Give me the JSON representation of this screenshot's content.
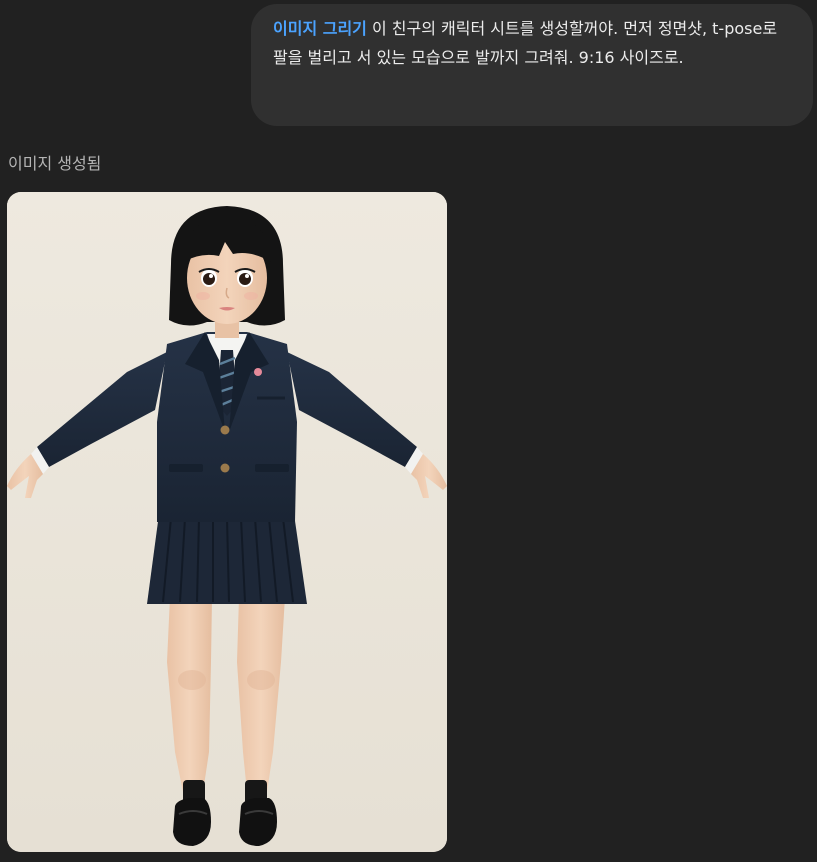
{
  "conversation": {
    "user_message": {
      "tool_tag": "이미지 그리기",
      "text": " 이 친구의 캐릭터 시트를 생성할꺼야. 먼저 정면샷, t-pose로 팔을 벌리고 서 있는 모습으로 발까지 그려줘. 9:16 사이즈로."
    },
    "assistant": {
      "status_label": "이미지 생성됨"
    }
  },
  "colors": {
    "page_bg": "#212121",
    "bubble_bg": "#303030",
    "tool_tag": "#4ba3ff",
    "text": "#ececec",
    "muted_text": "#b4b4b4",
    "image_bg": "#ebe6dc",
    "blazer": "#1f2a3a",
    "hair": "#141414",
    "skin": "#f1cfb4"
  }
}
